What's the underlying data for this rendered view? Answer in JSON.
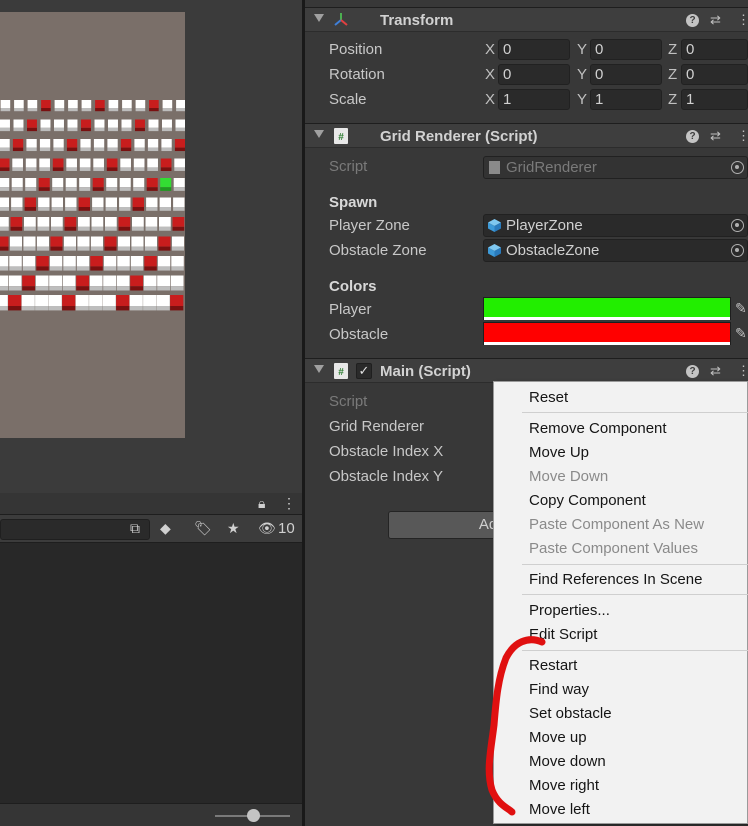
{
  "scene": {
    "background": "#7a6f69",
    "player_cell_color": "#33dd33",
    "obstacle_cell_color": "#c81d1d",
    "empty_cell_color": "#ffffff"
  },
  "hierarchy": {
    "visibility_count": "10"
  },
  "inspector": {
    "transform": {
      "title": "Transform",
      "position_label": "Position",
      "rotation_label": "Rotation",
      "scale_label": "Scale",
      "x": "X",
      "y": "Y",
      "z": "Z",
      "position": [
        "0",
        "0",
        "0"
      ],
      "rotation": [
        "0",
        "0",
        "0"
      ],
      "scale": [
        "1",
        "1",
        "1"
      ]
    },
    "grid_renderer": {
      "title": "Grid Renderer (Script)",
      "script_label": "Script",
      "script_value": "GridRenderer",
      "spawn_header": "Spawn",
      "player_zone_label": "Player Zone",
      "player_zone_value": "PlayerZone",
      "obstacle_zone_label": "Obstacle Zone",
      "obstacle_zone_value": "ObstacleZone",
      "colors_header": "Colors",
      "player_label": "Player",
      "player_color": "#22ee00",
      "obstacle_label": "Obstacle",
      "obstacle_color": "#ff0000"
    },
    "main": {
      "title": "Main (Script)",
      "script_label": "Script",
      "grid_renderer_label": "Grid Renderer",
      "obstacle_index_x_label": "Obstacle Index X",
      "obstacle_index_y_label": "Obstacle Index Y"
    },
    "add_component_partial": "Ad"
  },
  "context_menu": {
    "items": [
      {
        "label": "Reset",
        "enabled": true
      },
      {
        "label": "Remove Component",
        "enabled": true
      },
      {
        "label": "Move Up",
        "enabled": true
      },
      {
        "label": "Move Down",
        "enabled": false
      },
      {
        "label": "Copy Component",
        "enabled": true
      },
      {
        "label": "Paste Component As New",
        "enabled": false
      },
      {
        "label": "Paste Component Values",
        "enabled": false
      },
      {
        "label": "Find References In Scene",
        "enabled": true
      },
      {
        "label": "Properties...",
        "enabled": true
      },
      {
        "label": "Edit Script",
        "enabled": true
      },
      {
        "label": "Restart",
        "enabled": true
      },
      {
        "label": "Find way",
        "enabled": true
      },
      {
        "label": "Set obstacle",
        "enabled": true
      },
      {
        "label": "Move up",
        "enabled": true
      },
      {
        "label": "Move down",
        "enabled": true
      },
      {
        "label": "Move right",
        "enabled": true
      },
      {
        "label": "Move left",
        "enabled": true
      }
    ]
  },
  "annotation": {
    "scribble_color": "#e01010"
  }
}
